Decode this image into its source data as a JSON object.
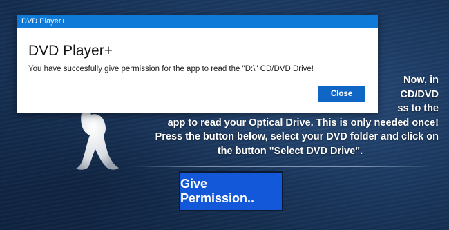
{
  "dialog": {
    "window_title": "DVD Player+",
    "heading": "DVD Player+",
    "message": "You have succesfully give permission for the app to read the \"D:\\\" CD/DVD Drive!",
    "close_label": "Close"
  },
  "background": {
    "instruction_lines": [
      "Now, in",
      "CD/DVD",
      "ss to the",
      "app to read your Optical Drive. This is only needed once!",
      "Press the button below, select your DVD folder and click on",
      "the button \"Select DVD Drive\"."
    ],
    "give_permission_label": "Give Permission.."
  },
  "colors": {
    "titlebar": "#0f7ad8",
    "close_button": "#0f66c4",
    "give_permission_button": "#1258d8",
    "background": "#1e3d66"
  },
  "icons": {
    "figure": "3d-white-figure-icon"
  }
}
